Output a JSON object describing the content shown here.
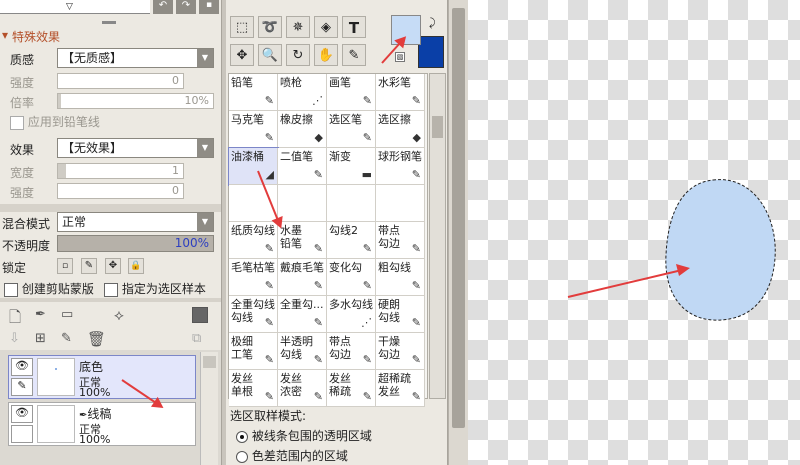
{
  "left": {
    "section_title": "特殊效果",
    "texture_label": "质感",
    "texture_value": "【无质感】",
    "intensity_label": "强度",
    "intensity_value": "0",
    "scale_label": "倍率",
    "scale_value": "10%",
    "apply_to_lineart": "应用到铅笔线",
    "effect_label": "效果",
    "effect_value": "【无效果】",
    "width_label": "宽度",
    "width_value": "1",
    "strength_label": "强度",
    "strength_value": "0",
    "blend_label": "混合模式",
    "blend_value": "正常",
    "opacity_label": "不透明度",
    "opacity_value": "100%",
    "opacity_fraction": 1.0,
    "lock_label": "锁定",
    "clip_label": "创建剪贴蒙版",
    "sel_sample_label": "指定为选区样本",
    "layers": [
      {
        "name": "底色",
        "mode": "正常",
        "opacity": "100%",
        "selected": true
      },
      {
        "name": "线稿",
        "mode": "正常",
        "opacity": "100%",
        "selected": false
      }
    ]
  },
  "mid": {
    "tools": [
      {
        "label": "铅笔",
        "icon": "pencil-icon"
      },
      {
        "label": "喷枪",
        "icon": "airbrush-icon"
      },
      {
        "label": "画笔",
        "icon": "brush-icon"
      },
      {
        "label": "水彩笔",
        "icon": "watercolor-icon"
      },
      {
        "label": "马克笔",
        "icon": "marker-icon"
      },
      {
        "label": "橡皮擦",
        "icon": "eraser-icon"
      },
      {
        "label": "选区笔",
        "icon": "selpen-icon"
      },
      {
        "label": "选区擦",
        "icon": "seleraser-icon"
      },
      {
        "label": "油漆桶",
        "icon": "bucket-icon"
      },
      {
        "label": "二值笔",
        "icon": "binary-pen-icon"
      },
      {
        "label": "渐变",
        "icon": "gradient-icon"
      },
      {
        "label": "球形钢笔",
        "icon": "ballpen-icon"
      },
      {
        "label": "",
        "icon": ""
      },
      {
        "label": "",
        "icon": ""
      },
      {
        "label": "",
        "icon": ""
      },
      {
        "label": "",
        "icon": ""
      },
      {
        "label": "纸质勾线",
        "icon": "pen-icon"
      },
      {
        "label": "水墨\n铅笔",
        "icon": "pen-icon"
      },
      {
        "label": "勾线2",
        "icon": "pen-icon"
      },
      {
        "label": "带点\n勾边",
        "icon": "pen-icon"
      },
      {
        "label": "毛笔枯笔",
        "icon": "pen-icon"
      },
      {
        "label": "戴痕毛笔",
        "icon": "pen-icon"
      },
      {
        "label": "变化勾",
        "icon": "pen-icon"
      },
      {
        "label": "粗勾线",
        "icon": "pen-icon"
      },
      {
        "label": "全重勾线\n勾线",
        "icon": "pen-icon"
      },
      {
        "label": "全重勾...",
        "icon": "pen-icon"
      },
      {
        "label": "多水勾线",
        "icon": "spray-icon"
      },
      {
        "label": "硬朗\n勾线",
        "icon": "pen-icon"
      },
      {
        "label": "极细\n工笔",
        "icon": "pen-icon"
      },
      {
        "label": "半透明\n勾线",
        "icon": "pen-icon"
      },
      {
        "label": "带点\n勾边",
        "icon": "pen-icon"
      },
      {
        "label": "干燥\n勾边",
        "icon": "pen-icon"
      },
      {
        "label": "发丝\n单根",
        "icon": "pen-icon"
      },
      {
        "label": "发丝\n浓密",
        "icon": "pen-icon"
      },
      {
        "label": "发丝\n稀疏",
        "icon": "pen-icon"
      },
      {
        "label": "超稀疏\n发丝",
        "icon": "pen-icon"
      }
    ],
    "sel_mode_title": "选区取样模式:",
    "sel_mode_opt1": "被线条包围的透明区域",
    "sel_mode_opt2": "色差范围内的区域",
    "fg_color": "#c6dcf6",
    "bg_color": "#0a3fa7",
    "text_tool": "T"
  },
  "canvas": {
    "shape_color": "#c0d8f4"
  }
}
